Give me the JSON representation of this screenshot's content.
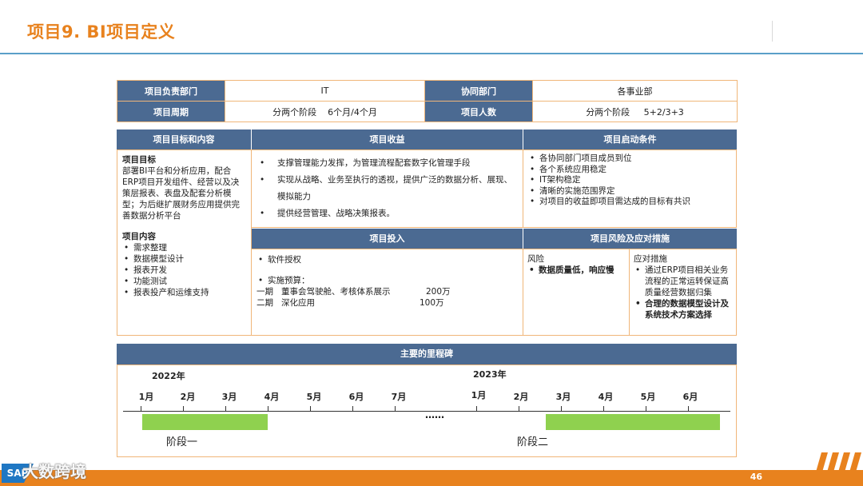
{
  "header": {
    "title": "项目9. BI项目定义"
  },
  "info_table": {
    "row1": {
      "label1": "项目负责部门",
      "value1": "IT",
      "label2": "协同部门",
      "value2": "各事业部"
    },
    "row2": {
      "label1": "项目周期",
      "value1": "分两个阶段    6个月/4个月",
      "label2": "项目人数",
      "value2": "分两个阶段     5+2/3+3"
    }
  },
  "goals": {
    "header": "项目目标和内容",
    "goal_title": "项目目标",
    "goal_text": "部署BI平台和分析应用，配合ERP项目开发组件、经营以及决策层报表、表盘及配套分析模型；为后继扩展财务应用提供完善数据分析平台",
    "content_title": "项目内容",
    "content_items": [
      "需求整理",
      "数据模型设计",
      "报表开发",
      "功能测试",
      "报表投产和运维支持"
    ]
  },
  "benefits": {
    "header": "项目收益",
    "items": [
      "支撑管理能力发挥，为管理流程配套数字化管理手段",
      "实现从战略、业务至执行的透视，提供广泛的数据分析、展现、模拟能力",
      "提供经营管理、战略决策报表。"
    ]
  },
  "startup": {
    "header": "项目启动条件",
    "items": [
      "各协同部门项目成员到位",
      "各个系统应用稳定",
      "IT架构稳定",
      "清晰的实施范围界定",
      "对项目的收益即项目需达成的目标有共识"
    ]
  },
  "investment": {
    "header": "项目投入",
    "item1": "软件授权",
    "budget_title": "实施预算：",
    "phase1_label": "一期   董事会驾驶舱、考核体系展示",
    "phase1_amount": "200万",
    "phase2_label": "二期   深化应用",
    "phase2_amount": "100万"
  },
  "risk": {
    "header": "项目风险及应对措施",
    "risk_title": "风险",
    "risk_item": "数据质量低，响应慢",
    "measures_title": "应对措施",
    "measure1": "通过ERP项目相关业务流程的正常运转保证高质量经营数据归集",
    "measure2": "合理的数据模型设计及系统技术方案选择"
  },
  "milestones": {
    "header": "主要的里程碑",
    "year1": "2022年",
    "year2": "2023年",
    "months1": [
      "1月",
      "2月",
      "3月",
      "4月",
      "5月",
      "6月",
      "7月"
    ],
    "months2": [
      "1月",
      "2月",
      "3月",
      "4月",
      "5月",
      "6月"
    ],
    "ellipsis": "……",
    "phase1": "阶段一",
    "phase2": "阶段二",
    "bar_color": "#8fd14f"
  },
  "footer": {
    "page_number": "46",
    "watermark": "大数跨境",
    "logo": "SAP"
  },
  "colors": {
    "accent": "#e8821e",
    "header_blue": "#4b6a92",
    "border": "#f0b679"
  }
}
